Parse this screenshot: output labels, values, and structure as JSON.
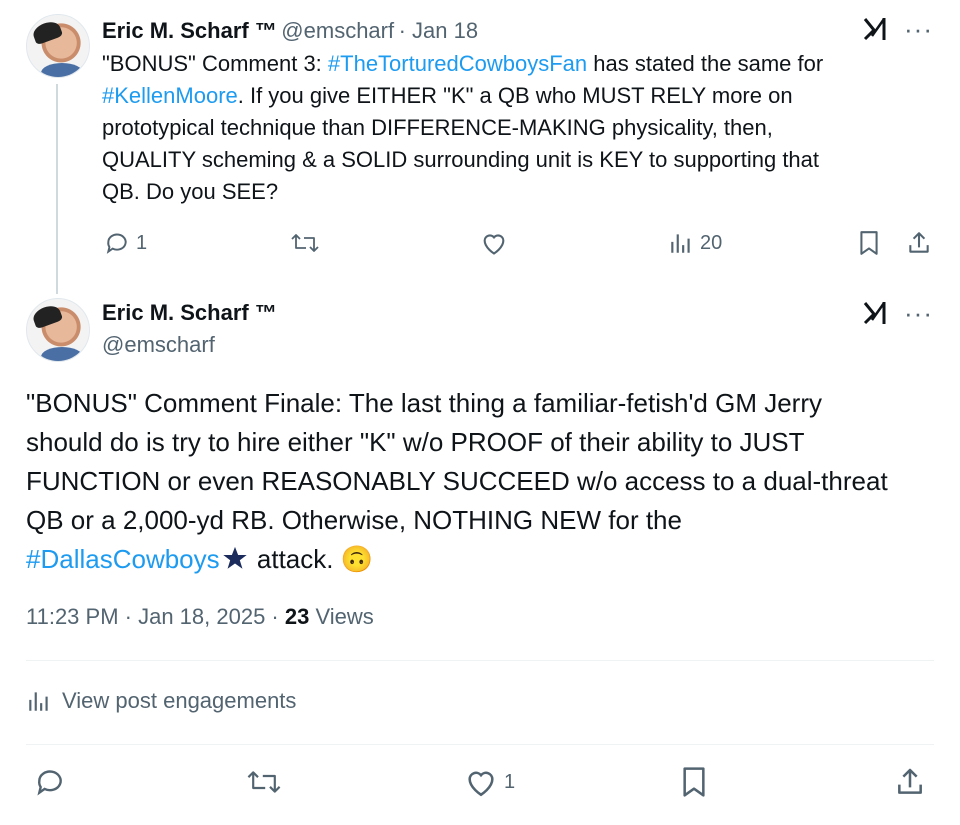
{
  "reply": {
    "name": "Eric M. Scharf ™",
    "handle": "@emscharf",
    "time": "· Jan 18",
    "text_parts": [
      "\"BONUS\" Comment 3: ",
      "#TheTorturedCowboysFan",
      " has stated the same for\n",
      "#KellenMoore",
      ". If you give EITHER \"K\" a QB who MUST RELY more on\nprototypical technique than DIFFERENCE-MAKING physicality, then,\nQUALITY scheming & a SOLID surrounding unit is KEY to supporting that\nQB. Do you SEE?"
    ],
    "replies": "1",
    "views": "20"
  },
  "main": {
    "name": "Eric M. Scharf ™",
    "handle": "@emscharf",
    "text_1": "\"BONUS\" Comment Finale: The last thing a familiar-fetish'd GM Jerry\nshould do is try to hire either \"K\" w/o PROOF of their ability to JUST\nFUNCTION or even REASONABLY SUCCEED w/o access to a dual-threat\nQB or a 2,000-yd RB. Otherwise, NOTHING NEW for the\n",
    "hashtag": "#DallasCowboys",
    "text_2": " attack. ",
    "emoji": "🙃",
    "timestamp": "11:23 PM · Jan 18, 2025 · ",
    "views_count": "23",
    "views_label": " Views",
    "engagements": "View post engagements",
    "likes": "1"
  },
  "icons": {
    "grok": "grok-icon",
    "more": "more-icon",
    "reply": "reply-icon",
    "retweet": "retweet-icon",
    "like": "like-icon",
    "views": "views-icon",
    "bookmark": "bookmark-icon",
    "share": "share-icon",
    "star": "cowboys-star-icon"
  },
  "colors": {
    "link": "#1d9bf0",
    "muted": "#536471",
    "text": "#0f1419"
  }
}
